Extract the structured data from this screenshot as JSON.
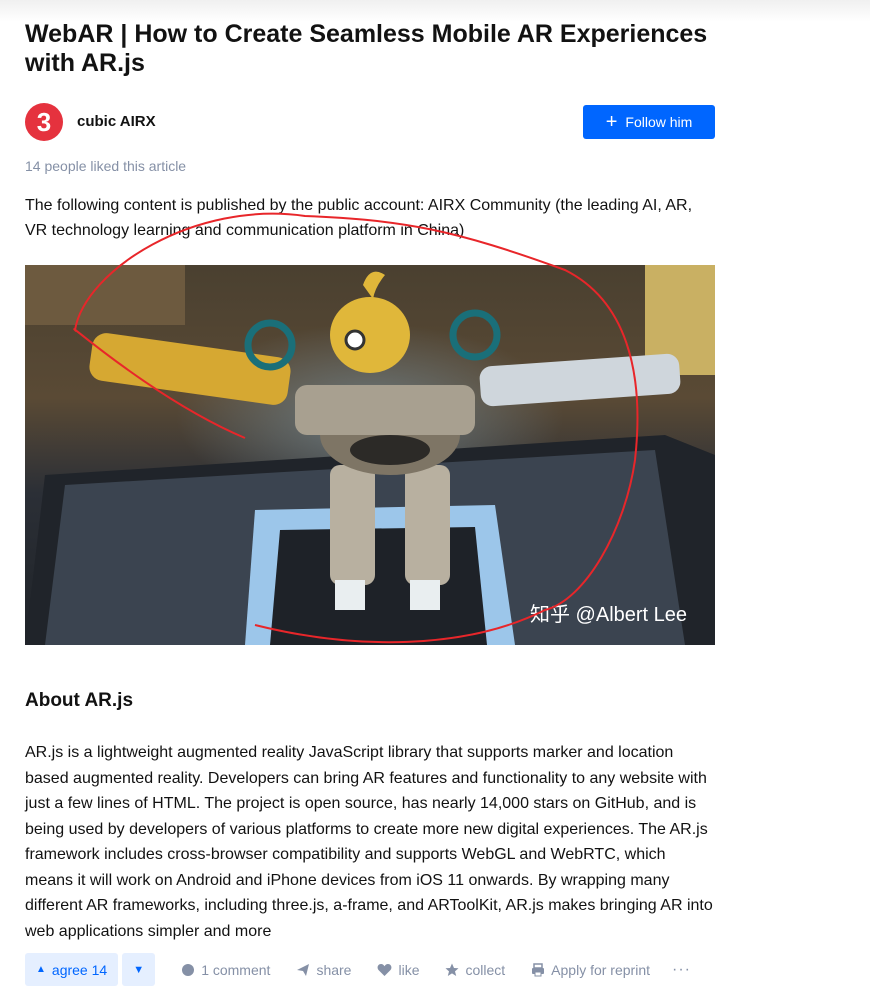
{
  "article": {
    "title": "WebAR | How to Create Seamless Mobile AR Experiences with AR.js",
    "author": {
      "name": "cubic AIRX",
      "avatar_text": "3",
      "follow_label": "Follow him"
    },
    "likes_text": "14 people liked this article",
    "intro": "The following content is published by the public account: AIRX Community (the leading AI, AR, VR technology learning and communication platform in China)",
    "image": {
      "watermark": "知乎 @Albert Lee"
    },
    "section_heading": "About AR.js",
    "body": "AR.js is a lightweight augmented reality JavaScript library that supports marker and location based augmented reality. Developers can bring AR features and functionality to any website with just a few lines of HTML. The project is open source, has nearly 14,000 stars on GitHub, and is being used by developers of various platforms to create more new digital experiences. The AR.js framework includes cross-browser compatibility and supports WebGL and WebRTC, which means it will work on Android and iPhone devices from iOS 11 onwards. By wrapping many different AR frameworks, including three.js, a-frame, and ARToolKit, AR.js makes bringing AR into web applications simpler and more"
  },
  "actions": {
    "agree_label": "agree 14",
    "comment_label": "1 comment",
    "share_label": "share",
    "like_label": "like",
    "collect_label": "collect",
    "reprint_label": "Apply for reprint",
    "more_label": "···"
  },
  "colors": {
    "accent": "#0066ff",
    "avatar": "#e5323e",
    "muted": "#8590a6",
    "annotation": "#e8262a"
  },
  "icons": [
    "plus-icon",
    "caret-up-icon",
    "caret-down-icon",
    "comment-icon",
    "share-icon",
    "heart-icon",
    "star-icon",
    "reprint-icon",
    "more-icon"
  ]
}
